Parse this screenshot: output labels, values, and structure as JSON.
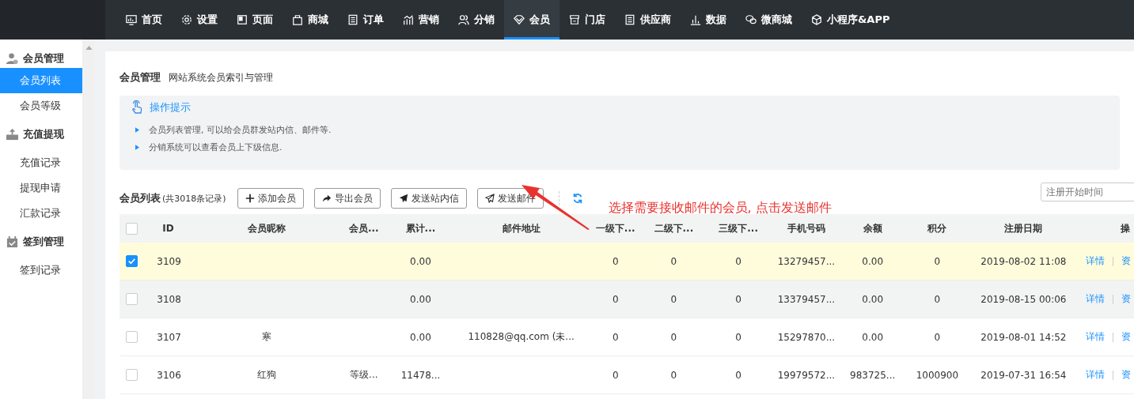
{
  "top_nav": [
    {
      "label": "首页",
      "kind": "monitor",
      "selected": false
    },
    {
      "label": "设置",
      "kind": "gear",
      "selected": false
    },
    {
      "label": "页面",
      "kind": "page",
      "selected": false
    },
    {
      "label": "商城",
      "kind": "bag",
      "selected": false
    },
    {
      "label": "订单",
      "kind": "list",
      "selected": false
    },
    {
      "label": "营销",
      "kind": "chart",
      "selected": false
    },
    {
      "label": "分销",
      "kind": "users",
      "selected": false
    },
    {
      "label": "会员",
      "kind": "diamond",
      "selected": true
    },
    {
      "label": "门店",
      "kind": "store",
      "selected": false
    },
    {
      "label": "供应商",
      "kind": "list",
      "selected": false
    },
    {
      "label": "数据",
      "kind": "bars",
      "selected": false
    },
    {
      "label": "微商城",
      "kind": "chat",
      "selected": false
    },
    {
      "label": "小程序&APP",
      "kind": "cube",
      "selected": false
    }
  ],
  "sidebar": [
    {
      "title": "会员管理",
      "kind": "user",
      "items": [
        {
          "label": "会员列表",
          "selected": true
        },
        {
          "label": "会员等级",
          "selected": false
        }
      ]
    },
    {
      "title": "充值提现",
      "kind": "cash",
      "items": [
        {
          "label": "充值记录",
          "selected": false
        },
        {
          "label": "提现申请",
          "selected": false
        },
        {
          "label": "汇款记录",
          "selected": false
        }
      ]
    },
    {
      "title": "签到管理",
      "kind": "calendar",
      "items": [
        {
          "label": "签到记录",
          "selected": false
        }
      ]
    }
  ],
  "page_header": {
    "title": "会员管理",
    "subtitle": "网站系统会员索引与管理"
  },
  "tips": {
    "title": "操作提示",
    "items": [
      "会员列表管理, 可以给会员群发站内信、邮件等.",
      "分销系统可以查看会员上下级信息."
    ]
  },
  "list": {
    "title": "会员列表",
    "count": "(共3018条记录)",
    "buttons": [
      {
        "label": "添加会员",
        "kind": "plus"
      },
      {
        "label": "导出会员",
        "kind": "share"
      },
      {
        "label": "发送站内信",
        "kind": "send"
      },
      {
        "label": "发送邮件",
        "kind": "send-outline"
      }
    ],
    "date_field": {
      "placeholder": "注册开始时间"
    }
  },
  "annotation": "选择需要接收邮件的会员, 点击发送邮件",
  "table": {
    "all_checked": false,
    "columns": [
      "ID",
      "会员昵称",
      "会员...",
      "累计...",
      "邮件地址",
      "一级下...",
      "二级下...",
      "三级下...",
      "手机号码",
      "余额",
      "积分",
      "注册日期",
      "操"
    ],
    "rows": [
      {
        "selected": true,
        "hovered": false,
        "cells": [
          "3109",
          "",
          "",
          "0.00",
          "",
          "0",
          "0",
          "0",
          "13279457...",
          "0.00",
          "0",
          "2019-08-02 11:08"
        ],
        "actions": [
          "详情",
          "资"
        ]
      },
      {
        "selected": false,
        "hovered": true,
        "cells": [
          "3108",
          "",
          "",
          "0.00",
          "",
          "0",
          "0",
          "0",
          "13379457...",
          "0.00",
          "0",
          "2019-08-15 00:06"
        ],
        "actions": [
          "详情",
          "资"
        ]
      },
      {
        "selected": false,
        "hovered": false,
        "cells": [
          "3107",
          "寒",
          "",
          "0.00",
          "110828@qq.com (未...",
          "0",
          "0",
          "0",
          "15297870...",
          "0.00",
          "0",
          "2019-08-01 14:52"
        ],
        "actions": [
          "详情",
          "资"
        ]
      },
      {
        "selected": false,
        "hovered": false,
        "cells": [
          "3106",
          "红狗",
          "等级...",
          "11478...",
          "",
          "0",
          "0",
          "0",
          "19979572...",
          "983725...",
          "1000900",
          "2019-07-31 16:54"
        ],
        "actions": [
          "详情",
          "资"
        ]
      }
    ]
  }
}
